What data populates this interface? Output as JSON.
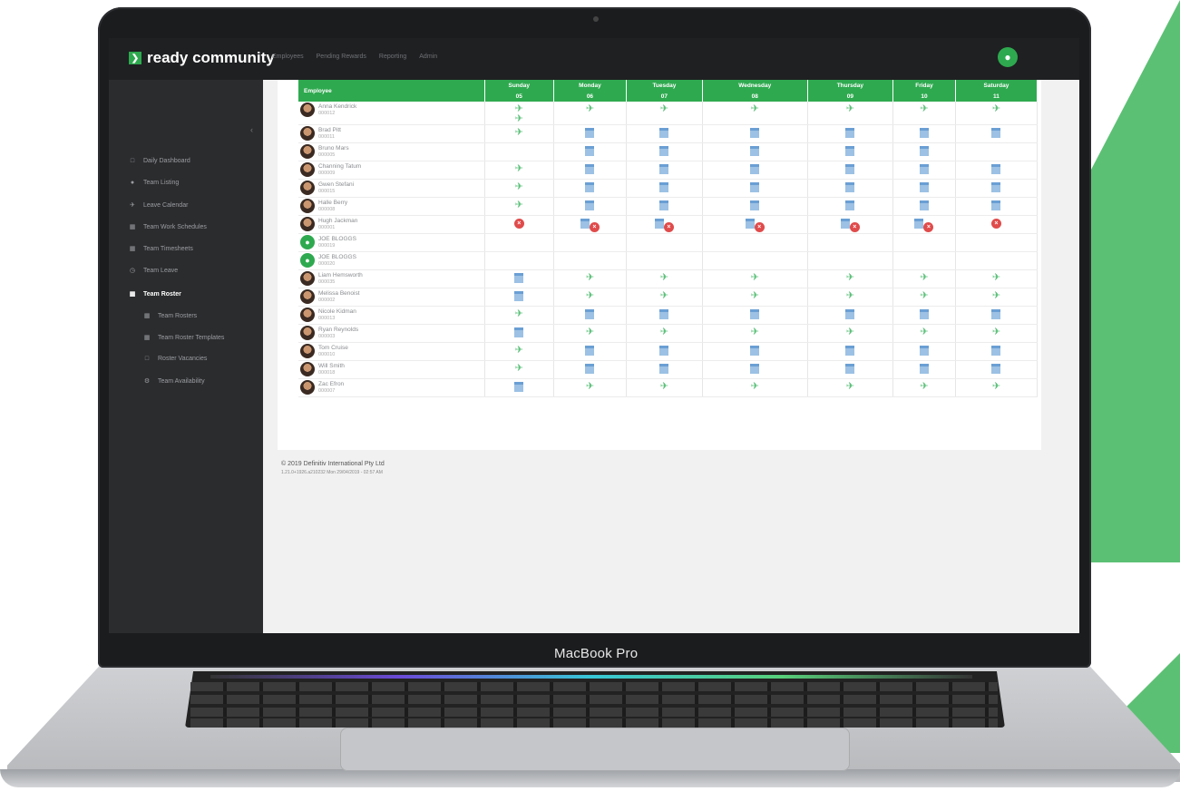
{
  "device": {
    "label": "MacBook Pro"
  },
  "app": {
    "logo": "ready community",
    "top_nav": [
      "Employees",
      "Pending Rewards",
      "Reporting",
      "Admin"
    ]
  },
  "sidebar": {
    "items": [
      {
        "label": "Daily Dashboard",
        "icon": "monitor-icon"
      },
      {
        "label": "Team Listing",
        "icon": "users-icon"
      },
      {
        "label": "Leave Calendar",
        "icon": "plane-icon"
      },
      {
        "label": "Team Work Schedules",
        "icon": "calendar-icon"
      },
      {
        "label": "Team Timesheets",
        "icon": "calendar-icon"
      },
      {
        "label": "Team Leave",
        "icon": "clock-icon"
      },
      {
        "label": "Team Roster",
        "icon": "calendar-icon",
        "active": true
      },
      {
        "label": "Team Rosters",
        "icon": "calendar-icon",
        "sub": true
      },
      {
        "label": "Team Roster Templates",
        "icon": "calendar-icon",
        "sub": true
      },
      {
        "label": "Roster Vacancies",
        "icon": "square-icon",
        "sub": true
      },
      {
        "label": "Team Availability",
        "icon": "gear-icon",
        "sub": true
      }
    ]
  },
  "roster": {
    "employee_header": "Employee",
    "days": [
      {
        "name": "Sunday",
        "date": "05"
      },
      {
        "name": "Monday",
        "date": "06"
      },
      {
        "name": "Tuesday",
        "date": "07"
      },
      {
        "name": "Wednesday",
        "date": "08"
      },
      {
        "name": "Thursday",
        "date": "09"
      },
      {
        "name": "Friday",
        "date": "10"
      },
      {
        "name": "Saturday",
        "date": "11"
      }
    ],
    "rows": [
      {
        "name": "Anna Kendrick",
        "id": "000012",
        "avatar": "photo",
        "cells": [
          "plane plane",
          "plane",
          "plane",
          "plane",
          "plane",
          "plane",
          "plane"
        ]
      },
      {
        "name": "Brad Pitt",
        "id": "000011",
        "avatar": "photo",
        "cells": [
          "plane",
          "cal",
          "cal",
          "cal",
          "cal",
          "cal",
          "cal"
        ]
      },
      {
        "name": "Bruno Mars",
        "id": "000005",
        "avatar": "photo",
        "cells": [
          "",
          "cal",
          "cal",
          "cal",
          "cal",
          "cal",
          ""
        ]
      },
      {
        "name": "Channing Tatum",
        "id": "000009",
        "avatar": "photo",
        "cells": [
          "plane",
          "cal",
          "cal",
          "cal",
          "cal",
          "cal",
          "cal"
        ]
      },
      {
        "name": "Gwen Stefani",
        "id": "000015",
        "avatar": "photo",
        "cells": [
          "plane",
          "cal",
          "cal",
          "cal",
          "cal",
          "cal",
          "cal"
        ]
      },
      {
        "name": "Halle Berry",
        "id": "000008",
        "avatar": "photo",
        "cells": [
          "plane",
          "cal",
          "cal",
          "cal",
          "cal",
          "cal",
          "cal"
        ]
      },
      {
        "name": "Hugh Jackman",
        "id": "000001",
        "avatar": "photo",
        "cells": [
          "cross",
          "cal cross",
          "cal cross",
          "cal cross",
          "cal cross",
          "cal cross",
          "cross"
        ]
      },
      {
        "name": "JOE BLOGGS",
        "id": "000019",
        "avatar": "user",
        "cells": [
          "",
          "",
          "",
          "",
          "",
          "",
          ""
        ]
      },
      {
        "name": "JOE BLOGGS",
        "id": "000020",
        "avatar": "user",
        "cells": [
          "",
          "",
          "",
          "",
          "",
          "",
          ""
        ]
      },
      {
        "name": "Liam Hemsworth",
        "id": "000035",
        "avatar": "photo",
        "cells": [
          "cal",
          "plane",
          "plane",
          "plane",
          "plane",
          "plane",
          "plane"
        ]
      },
      {
        "name": "Melissa Benoist",
        "id": "000002",
        "avatar": "photo",
        "cells": [
          "cal",
          "plane",
          "plane",
          "plane",
          "plane",
          "plane",
          "plane"
        ]
      },
      {
        "name": "Nicole Kidman",
        "id": "000013",
        "avatar": "photo",
        "cells": [
          "plane",
          "cal",
          "cal",
          "cal",
          "cal",
          "cal",
          "cal"
        ]
      },
      {
        "name": "Ryan Reynolds",
        "id": "000003",
        "avatar": "photo",
        "cells": [
          "cal",
          "plane",
          "plane",
          "plane",
          "plane",
          "plane",
          "plane"
        ]
      },
      {
        "name": "Tom Cruise",
        "id": "000010",
        "avatar": "photo",
        "cells": [
          "plane",
          "cal",
          "cal",
          "cal",
          "cal",
          "cal",
          "cal"
        ]
      },
      {
        "name": "Will Smith",
        "id": "000018",
        "avatar": "photo",
        "cells": [
          "plane",
          "cal",
          "cal",
          "cal",
          "cal",
          "cal",
          "cal"
        ]
      },
      {
        "name": "Zac Efron",
        "id": "000007",
        "avatar": "photo",
        "cells": [
          "cal",
          "plane",
          "plane",
          "plane",
          "plane",
          "plane",
          "plane"
        ]
      }
    ]
  },
  "footer": {
    "copyright": "© 2019 Definitiv International Pty Ltd",
    "version": "1.21.0+1926.a210232 Mon 29/04/2019 - 02:57 AM"
  },
  "colors": {
    "accent": "#2ea94f",
    "sidebar_bg": "#2b2c2e",
    "plane": "#5cc07a",
    "calendar": "#9cc1e4",
    "cross": "#e04b4b"
  }
}
